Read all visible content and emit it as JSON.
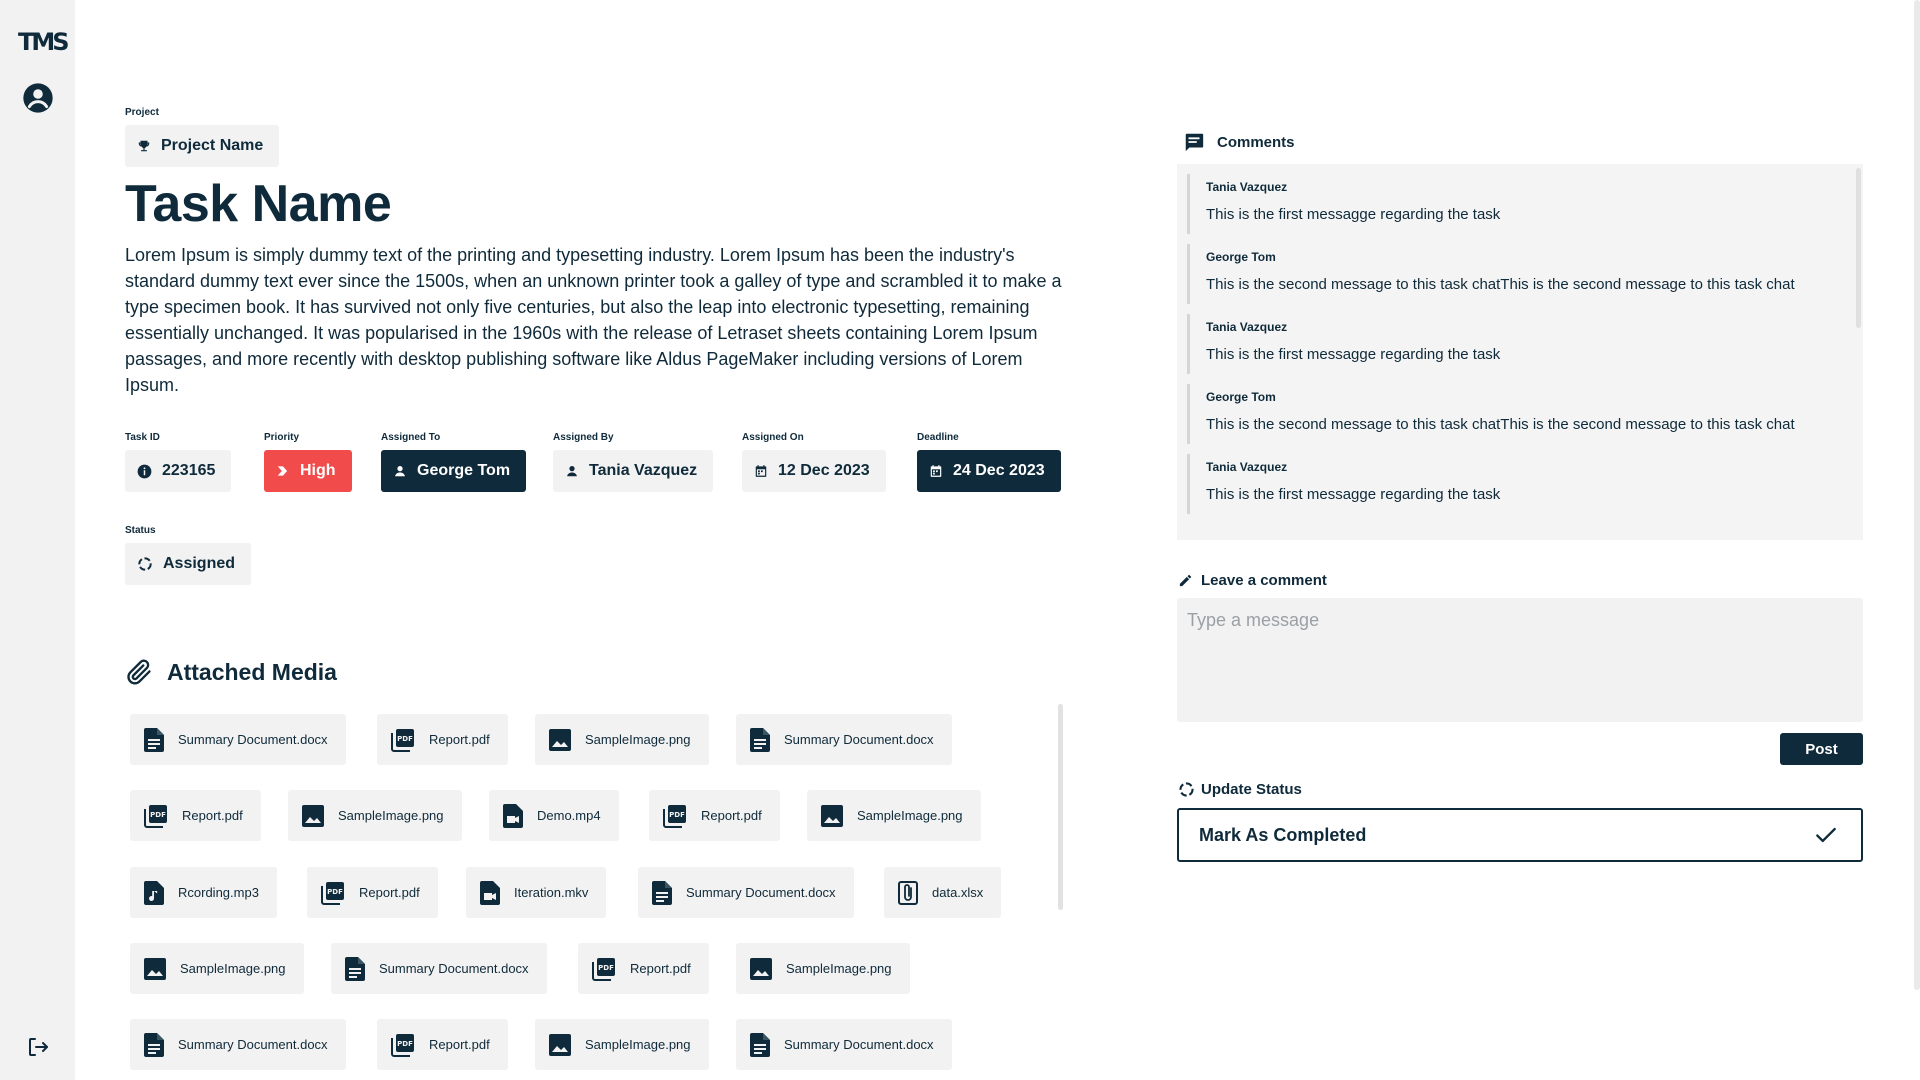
{
  "sidebar": {
    "logo": "TMS",
    "user_icon": "user-circle-icon",
    "logout_icon": "logout-icon"
  },
  "project": {
    "label": "Project",
    "name": "Project Name",
    "icon": "trophy-icon"
  },
  "task": {
    "title": "Task Name",
    "description": "Lorem Ipsum is simply dummy text of the printing and typesetting industry. Lorem Ipsum has been the industry's standard dummy text ever since the 1500s, when an unknown printer took a galley of type and scrambled it to make a type specimen book. It has survived not only five centuries, but also the leap into electronic typesetting, remaining essentially unchanged. It was popularised in the 1960s with the release of Letraset sheets containing Lorem Ipsum passages, and more recently with desktop publishing software like Aldus PageMaker including versions of Lorem Ipsum."
  },
  "meta": {
    "task_id": {
      "label": "Task ID",
      "value": "223165"
    },
    "priority": {
      "label": "Priority",
      "value": "High"
    },
    "assigned_to": {
      "label": "Assigned To",
      "value": "George Tom"
    },
    "assigned_by": {
      "label": "Assigned By",
      "value": "Tania Vazquez"
    },
    "assigned_on": {
      "label": "Assigned On",
      "value": "12 Dec 2023"
    },
    "deadline": {
      "label": "Deadline",
      "value": "24 Dec 2023"
    },
    "status": {
      "label": "Status",
      "value": "Assigned"
    }
  },
  "colors": {
    "primary": "#0f2a3a",
    "priority_high": "#f24b4b",
    "chip_bg": "#f2f2f2"
  },
  "media": {
    "title": "Attached Media",
    "files": [
      {
        "name": "Summary Document.docx",
        "type": "doc"
      },
      {
        "name": "Report.pdf",
        "type": "pdf"
      },
      {
        "name": "SampleImage.png",
        "type": "image"
      },
      {
        "name": "Summary Document.docx",
        "type": "doc"
      },
      {
        "name": "Report.pdf",
        "type": "pdf"
      },
      {
        "name": "SampleImage.png",
        "type": "image"
      },
      {
        "name": "Demo.mp4",
        "type": "video"
      },
      {
        "name": "Report.pdf",
        "type": "pdf"
      },
      {
        "name": "SampleImage.png",
        "type": "image"
      },
      {
        "name": "Rcording.mp3",
        "type": "audio"
      },
      {
        "name": "Report.pdf",
        "type": "pdf"
      },
      {
        "name": "Iteration.mkv",
        "type": "video"
      },
      {
        "name": "Summary Document.docx",
        "type": "doc"
      },
      {
        "name": "data.xlsx",
        "type": "clip"
      },
      {
        "name": "SampleImage.png",
        "type": "image"
      },
      {
        "name": "Summary Document.docx",
        "type": "doc"
      },
      {
        "name": "Report.pdf",
        "type": "pdf"
      },
      {
        "name": "SampleImage.png",
        "type": "image"
      },
      {
        "name": "Summary Document.docx",
        "type": "doc"
      },
      {
        "name": "Report.pdf",
        "type": "pdf"
      },
      {
        "name": "SampleImage.png",
        "type": "image"
      },
      {
        "name": "Summary Document.docx",
        "type": "doc"
      }
    ]
  },
  "comments": {
    "title": "Comments",
    "items": [
      {
        "author": "Tania Vazquez",
        "text": "This is the first messagge regarding the task"
      },
      {
        "author": "George Tom",
        "text": "This is the second message to this task chatThis is the second message to this task chat"
      },
      {
        "author": "Tania Vazquez",
        "text": "This is the first messagge regarding the task"
      },
      {
        "author": "George Tom",
        "text": "This is the second message to this task chatThis is the second message to this task chat"
      },
      {
        "author": "Tania Vazquez",
        "text": "This is the first messagge regarding the task"
      }
    ]
  },
  "leave_comment": {
    "title": "Leave a comment",
    "placeholder": "Type a message",
    "post_label": "Post"
  },
  "update_status": {
    "title": "Update Status",
    "button_label": "Mark As Completed"
  }
}
